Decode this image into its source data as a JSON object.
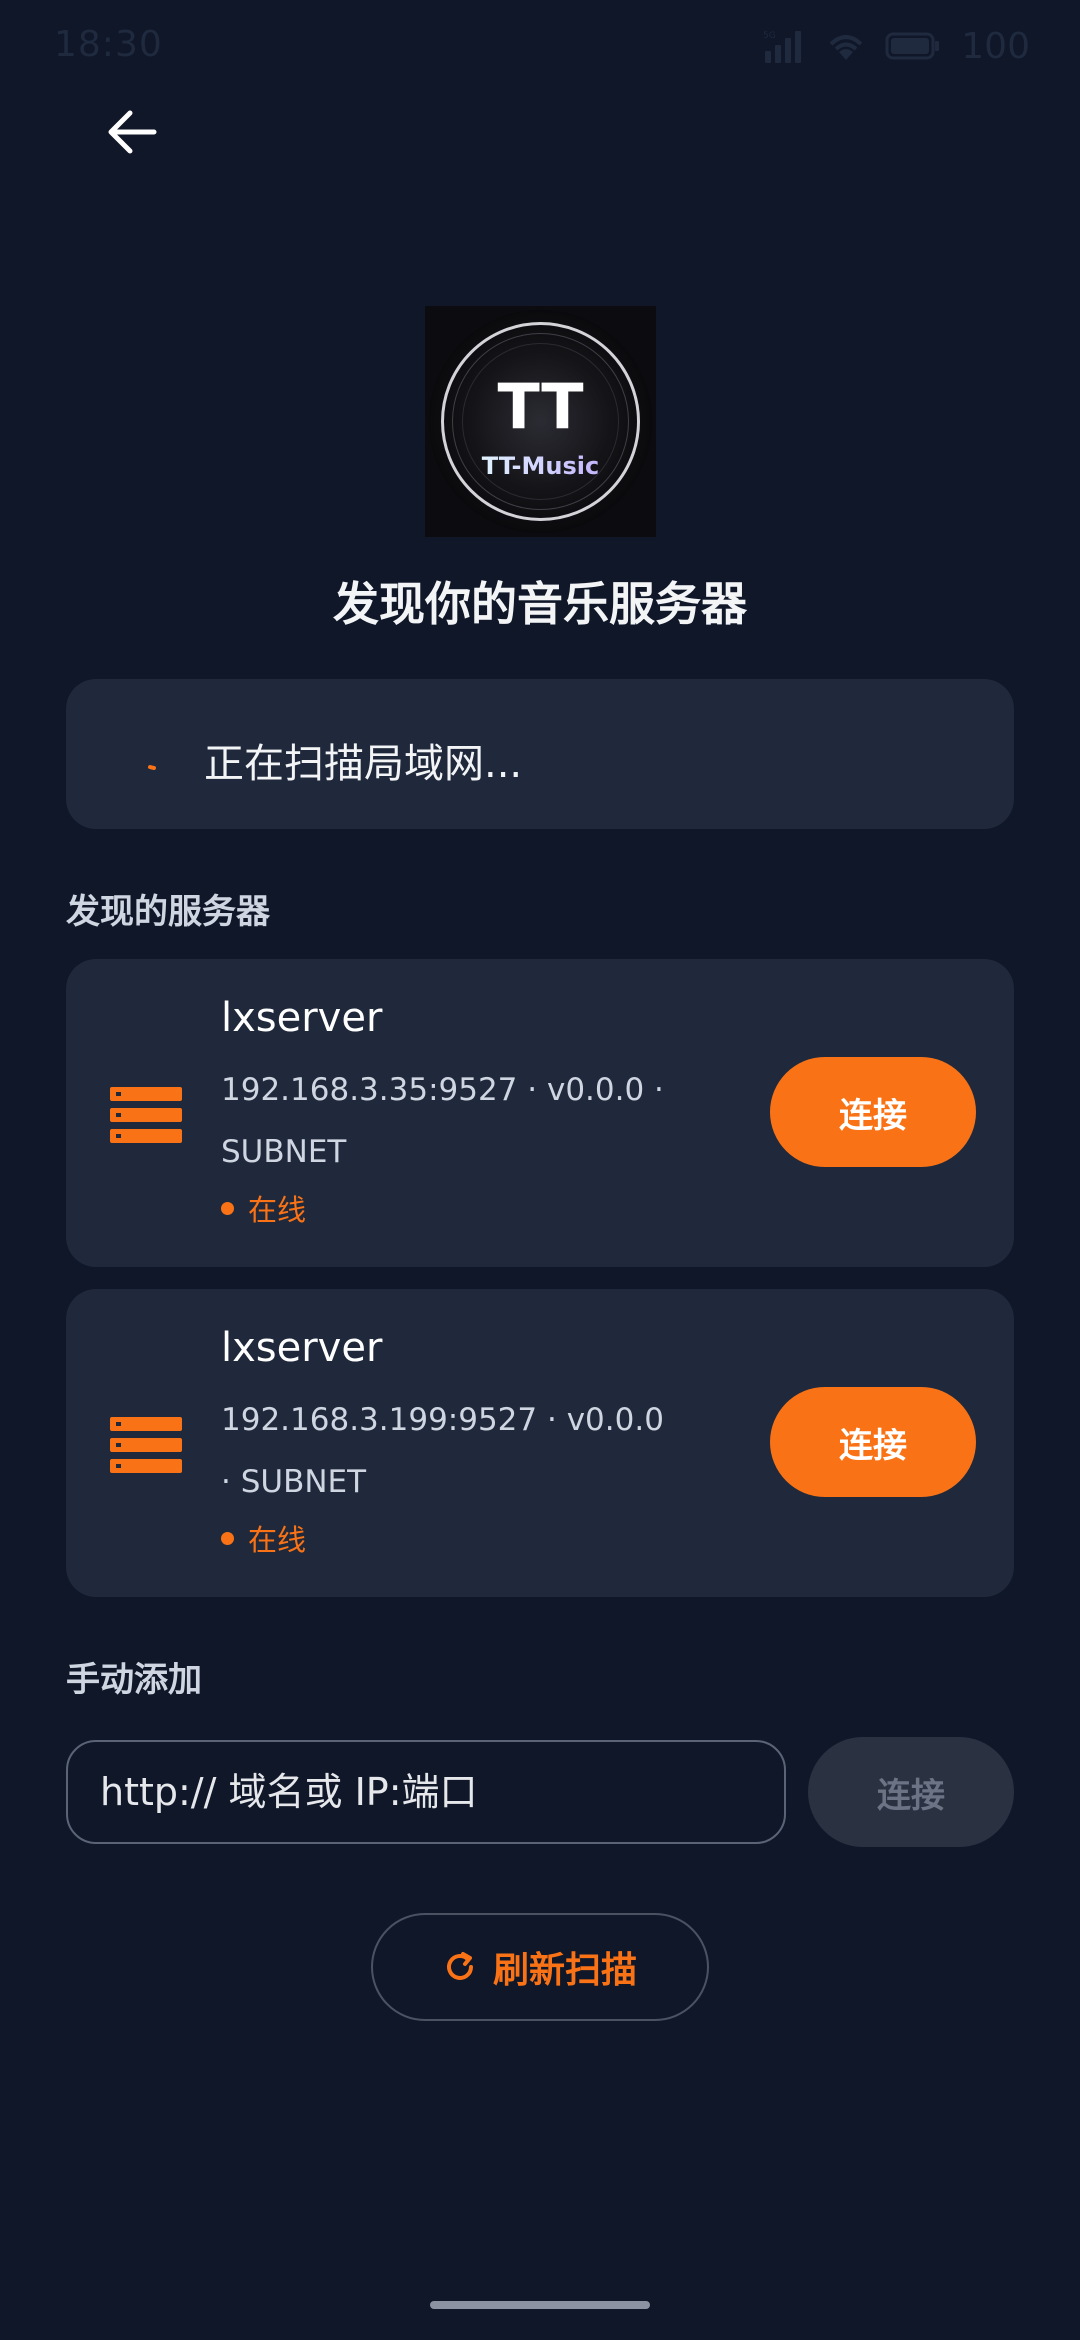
{
  "status_bar": {
    "time": "18:30",
    "network": "5G",
    "battery": "100"
  },
  "header": {
    "back_icon": "arrow-left-icon",
    "logo_text": "TT-Music",
    "title": "发现你的音乐服务器"
  },
  "scanning": {
    "text": "正在扫描局域网..."
  },
  "discovered": {
    "section_label": "发现的服务器",
    "servers": [
      {
        "name": "lxserver",
        "meta": "192.168.3.35:9527 · v0.0.0 · SUBNET",
        "status": "在线",
        "connect_label": "连接"
      },
      {
        "name": "lxserver",
        "meta": "192.168.3.199:9527 · v0.0.0 · SUBNET",
        "status": "在线",
        "connect_label": "连接"
      }
    ]
  },
  "manual": {
    "section_label": "手动添加",
    "placeholder": "http:// 域名或 IP:端口",
    "connect_label": "连接"
  },
  "refresh": {
    "label": "刷新扫描",
    "icon": "refresh-icon"
  },
  "colors": {
    "background": "#0f1729",
    "card": "#1f293b",
    "accent": "#f97316",
    "disabled_button": "#2a3242"
  }
}
